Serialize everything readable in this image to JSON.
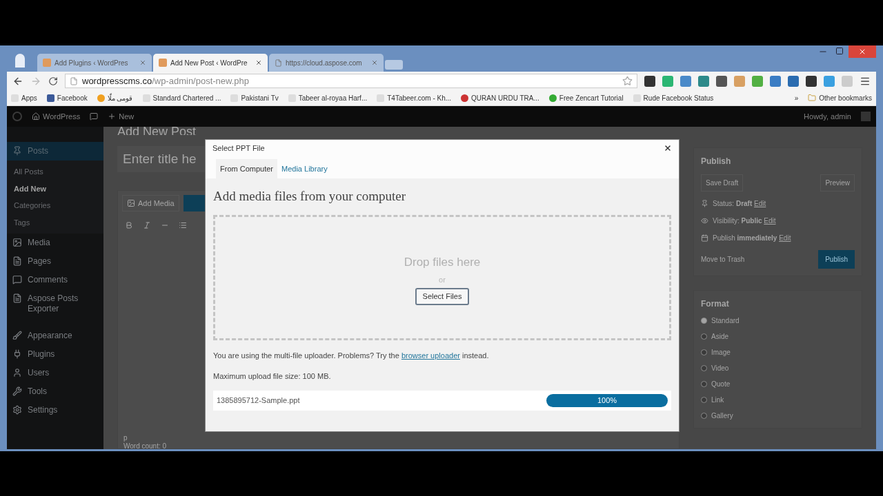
{
  "browser": {
    "tabs": [
      {
        "title": "Add Plugins ‹ WordPres",
        "selected": false
      },
      {
        "title": "Add New Post ‹ WordPre",
        "selected": true
      },
      {
        "title": "https://cloud.aspose.com",
        "selected": false
      }
    ],
    "address": {
      "host": "wordpresscms.co",
      "path": "/wp-admin/post-new.php"
    },
    "bookmarks": [
      {
        "label": "Apps"
      },
      {
        "label": "Facebook"
      },
      {
        "label": "قومی ملّا"
      },
      {
        "label": "Standard Chartered ..."
      },
      {
        "label": "Pakistani Tv"
      },
      {
        "label": "Tabeer al-royaa Harf..."
      },
      {
        "label": "T4Tabeer.com - Kh..."
      },
      {
        "label": "QURAN URDU TRA..."
      },
      {
        "label": "Free Zencart Tutorial"
      },
      {
        "label": "Rude Facebook Status"
      }
    ],
    "more": "»",
    "other_bookmarks": "Other bookmarks"
  },
  "admin_bar": {
    "items": [
      "WordPress",
      "New"
    ],
    "greeting": "Howdy, admin"
  },
  "sidebar": {
    "items": [
      {
        "label": "Posts",
        "selected": true,
        "children": [
          {
            "label": "All Posts",
            "selected": false
          },
          {
            "label": "Add New",
            "selected": true
          },
          {
            "label": "Categories",
            "selected": false
          },
          {
            "label": "Tags",
            "selected": false
          }
        ]
      },
      {
        "label": "Media",
        "selected": false
      },
      {
        "label": "Pages",
        "selected": false
      },
      {
        "label": "Comments",
        "selected": false
      },
      {
        "label": "Aspose Posts Exporter",
        "selected": false
      },
      {
        "label": "Appearance",
        "selected": false
      },
      {
        "label": "Plugins",
        "selected": false
      },
      {
        "label": "Users",
        "selected": false
      },
      {
        "label": "Tools",
        "selected": false
      },
      {
        "label": "Settings",
        "selected": false
      }
    ]
  },
  "editor": {
    "heading": "Add New Post",
    "title_placeholder": "Enter title he",
    "add_media": "Add Media",
    "path": "p",
    "word_count": "Word count: 0"
  },
  "publish": {
    "title": "Publish",
    "save_draft": "Save Draft",
    "preview": "Preview",
    "rows": [
      {
        "label": "Status:",
        "value": "Draft",
        "link": "Edit"
      },
      {
        "label": "Visibility:",
        "value": "Public",
        "link": "Edit"
      },
      {
        "label": "Publish",
        "value": "immediately",
        "link": "Edit"
      }
    ],
    "trash": "Move to Trash",
    "publish_button": "Publish"
  },
  "format": {
    "title": "Format",
    "options": [
      {
        "label": "Standard",
        "selected": true
      },
      {
        "label": "Aside",
        "selected": false
      },
      {
        "label": "Image",
        "selected": false
      },
      {
        "label": "Video",
        "selected": false
      },
      {
        "label": "Quote",
        "selected": false
      },
      {
        "label": "Link",
        "selected": false
      },
      {
        "label": "Gallery",
        "selected": false
      }
    ]
  },
  "modal": {
    "title": "Select PPT File",
    "tabs": [
      {
        "label": "From Computer",
        "selected": true
      },
      {
        "label": "Media Library",
        "selected": false
      }
    ],
    "heading": "Add media files from your computer",
    "drop_text": "Drop files here",
    "or": "or",
    "select_button": "Select Files",
    "info_before": "You are using the multi-file uploader. Problems? Try the",
    "info_link": "browser uploader",
    "info_after": "instead.",
    "max_size": "Maximum upload file size: 100 MB.",
    "upload": {
      "filename": "1385895712-Sample.ppt",
      "level": 1,
      "reading": "100%"
    }
  }
}
